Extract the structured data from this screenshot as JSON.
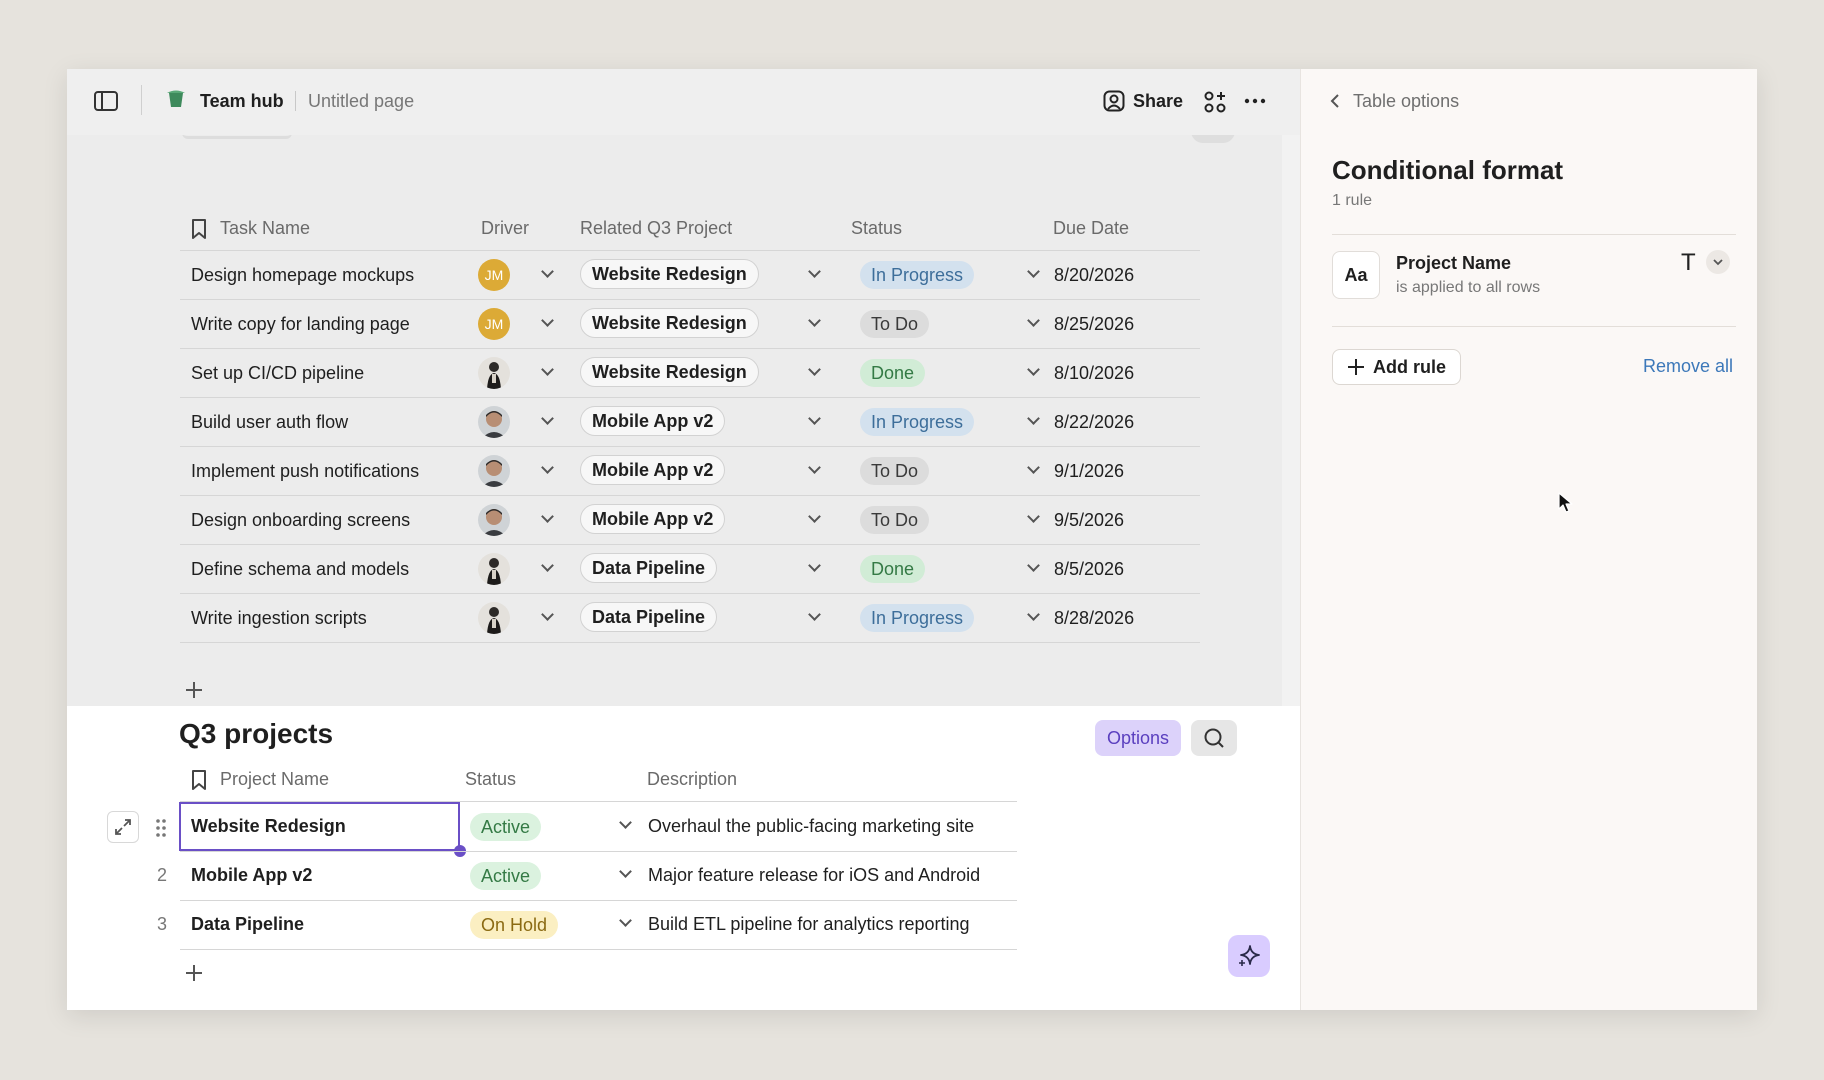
{
  "topbar": {
    "workspace": "Team hub",
    "page": "Untitled page",
    "share": "Share"
  },
  "tasks": {
    "columns": [
      "Task Name",
      "Driver",
      "Related Q3 Project",
      "Status",
      "Due Date"
    ],
    "rows": [
      {
        "name": "Design homepage mockups",
        "driver": "JM",
        "project": "Website Redesign",
        "status": "In Progress",
        "due": "8/20/2026"
      },
      {
        "name": "Write copy for landing page",
        "driver": "JM",
        "project": "Website Redesign",
        "status": "To Do",
        "due": "8/25/2026"
      },
      {
        "name": "Set up CI/CD pipeline",
        "driver": "",
        "project": "Website Redesign",
        "status": "Done",
        "due": "8/10/2026"
      },
      {
        "name": "Build user auth flow",
        "driver": "",
        "project": "Mobile App v2",
        "status": "In Progress",
        "due": "8/22/2026"
      },
      {
        "name": "Implement push notifications",
        "driver": "",
        "project": "Mobile App v2",
        "status": "To Do",
        "due": "9/1/2026"
      },
      {
        "name": "Design onboarding screens",
        "driver": "",
        "project": "Mobile App v2",
        "status": "To Do",
        "due": "9/5/2026"
      },
      {
        "name": "Define schema and models",
        "driver": "",
        "project": "Data Pipeline",
        "status": "Done",
        "due": "8/5/2026"
      },
      {
        "name": "Write ingestion scripts",
        "driver": "",
        "project": "Data Pipeline",
        "status": "In Progress",
        "due": "8/28/2026"
      }
    ]
  },
  "projects": {
    "title": "Q3 projects",
    "options_label": "Options",
    "columns": [
      "Project Name",
      "Status",
      "Description"
    ],
    "rows": [
      {
        "num": "",
        "name": "Website Redesign",
        "status": "Active",
        "description": "Overhaul the public-facing marketing site"
      },
      {
        "num": "2",
        "name": "Mobile App v2",
        "status": "Active",
        "description": "Major feature release for iOS and Android"
      },
      {
        "num": "3",
        "name": "Data Pipeline",
        "status": "On Hold",
        "description": "Build ETL pipeline for analytics reporting"
      }
    ]
  },
  "sidebar": {
    "back_label": "Table options",
    "title": "Conditional format",
    "subtitle": "1 rule",
    "rule": {
      "icon_text": "Aa",
      "name": "Project Name",
      "desc": "is applied to all rows",
      "format_glyph": "T"
    },
    "add_rule": "Add rule",
    "remove_all": "Remove all"
  },
  "colors": {
    "accent_purple": "#6a4fc6",
    "options_bg": "#dcd2fa",
    "link_blue": "#3c78b9"
  }
}
